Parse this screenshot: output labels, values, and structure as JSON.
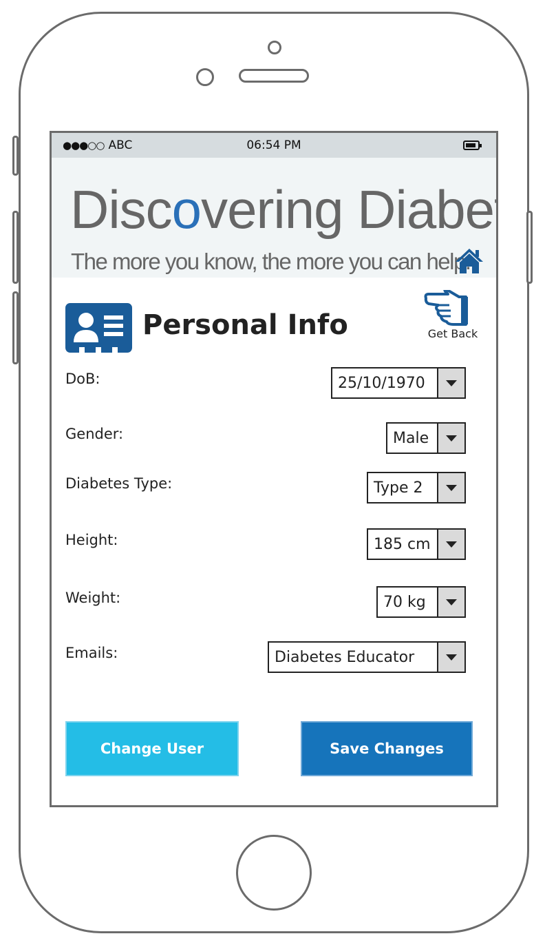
{
  "status_bar": {
    "signal": "●●●○○",
    "carrier": "ABC",
    "time": "06:54 PM",
    "battery_icon": "battery-icon"
  },
  "banner": {
    "title_part1": "Disc",
    "title_o": "o",
    "title_part2": "vering Diabetes",
    "tagline": "The more you know, the more you can help.",
    "home_icon": "home-icon",
    "accent_color": "#1a5c99"
  },
  "header": {
    "title": "Personal Info",
    "icon": "id-card-icon",
    "get_back_label": "Get Back",
    "get_back_icon": "pointing-hand-icon"
  },
  "form": {
    "dob": {
      "label": "DoB:",
      "value": "25/10/1970"
    },
    "gender": {
      "label": "Gender:",
      "value": "Male"
    },
    "diabetes_type": {
      "label": "Diabetes Type:",
      "value": "Type 2"
    },
    "height": {
      "label": "Height:",
      "value": "185 cm"
    },
    "weight": {
      "label": "Weight:",
      "value": "70 kg"
    },
    "emails": {
      "label": "Emails:",
      "value": "Diabetes Educator"
    }
  },
  "actions": {
    "change_user": "Change User",
    "save_changes": "Save Changes"
  },
  "colors": {
    "change_user_bg": "#24bde6",
    "save_changes_bg": "#1674bb",
    "icon_blue": "#1a5c99"
  }
}
